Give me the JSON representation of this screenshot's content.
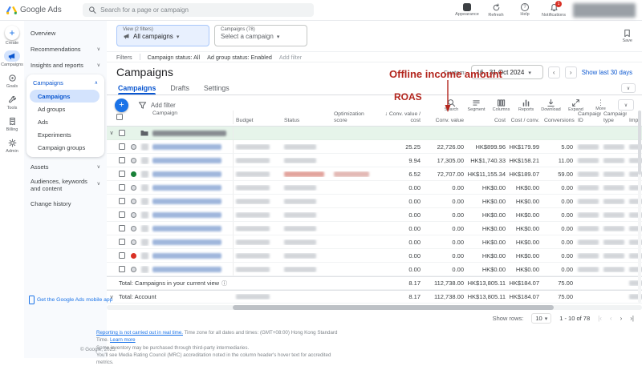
{
  "topbar": {
    "logo_text": "Google Ads",
    "search_placeholder": "Search for a page or campaign",
    "actions": [
      {
        "label": "Appearance"
      },
      {
        "label": "Refresh"
      },
      {
        "label": "Help"
      },
      {
        "label": "Notifications",
        "badge": "1"
      }
    ]
  },
  "rail": [
    {
      "label": "Create"
    },
    {
      "label": "Campaigns"
    },
    {
      "label": "Goals"
    },
    {
      "label": "Tools"
    },
    {
      "label": "Billing"
    },
    {
      "label": "Admin"
    }
  ],
  "nav": {
    "overview": "Overview",
    "recommendations": "Recommendations",
    "insights": "Insights and reports",
    "campaigns_parent": "Campaigns",
    "campaigns_children": [
      "Campaigns",
      "Ad groups",
      "Ads",
      "Experiments",
      "Campaign groups"
    ],
    "assets": "Assets",
    "audiences": "Audiences, keywords and content",
    "change_history": "Change history",
    "mobile_app": "Get the Google Ads mobile app"
  },
  "view_controls": {
    "view_label": "View (2 filters)",
    "view_value": "All campaigns",
    "campaigns_label": "Campaigns (78)",
    "campaigns_value": "Select a campaign",
    "save_label": "Save"
  },
  "filter_bar": {
    "filters_label": "Filters",
    "chip_campaign_status": "Campaign status: All",
    "chip_ad_group_status": "Ad group status: Enabled",
    "add_filter": "Add filter"
  },
  "page": {
    "title": "Campaigns",
    "date_prefix": "Custom:",
    "date_range": "16 - 31 Oct 2024",
    "quick_range": "Show last 30 days"
  },
  "tabs": [
    {
      "label": "Campaigns"
    },
    {
      "label": "Drafts"
    },
    {
      "label": "Settings"
    }
  ],
  "annotations": {
    "offline_income": "Offline income amount",
    "roas": "ROAS"
  },
  "toolbar": {
    "add_filter": "Add filter",
    "tools": [
      {
        "label": "Search"
      },
      {
        "label": "Segment"
      },
      {
        "label": "Columns"
      },
      {
        "label": "Reports"
      },
      {
        "label": "Download"
      },
      {
        "label": "Expand"
      },
      {
        "label": "More"
      }
    ]
  },
  "table": {
    "headers": {
      "campaign": "Campaign",
      "budget": "Budget",
      "status": "Status",
      "opt_score": "Optimization score",
      "conv_value_cost": "↓ Conv. value / cost",
      "conv_value": "Conv. value",
      "cost": "Cost",
      "cost_conv": "Cost / conv.",
      "conversions": "Conversions",
      "campaign_id": "Campaign ID",
      "campaign_type": "Campaign type",
      "impr": "Impr."
    },
    "rows": [
      {
        "kind": "group"
      },
      {
        "kind": "data",
        "dot": "gray",
        "cvc": "25.25",
        "cv": "22,726.00",
        "cost": "HK$899.96",
        "cpc": "HK$179.99",
        "conv": "5.00"
      },
      {
        "kind": "data",
        "dot": "gray",
        "cvc": "9.94",
        "cv": "17,305.00",
        "cost": "HK$1,740.33",
        "cpc": "HK$158.21",
        "conv": "11.00"
      },
      {
        "kind": "data",
        "dot": "green",
        "status_alert": true,
        "opt_blur": true,
        "cvc": "6.52",
        "cv": "72,707.00",
        "cost": "HK$11,155.34",
        "cpc": "HK$189.07",
        "conv": "59.00"
      },
      {
        "kind": "data",
        "dot": "gray",
        "cvc": "0.00",
        "cv": "0.00",
        "cost": "HK$0.00",
        "cpc": "HK$0.00",
        "conv": "0.00"
      },
      {
        "kind": "data",
        "dot": "gray",
        "cvc": "0.00",
        "cv": "0.00",
        "cost": "HK$0.00",
        "cpc": "HK$0.00",
        "conv": "0.00"
      },
      {
        "kind": "data",
        "dot": "gray",
        "cvc": "0.00",
        "cv": "0.00",
        "cost": "HK$0.00",
        "cpc": "HK$0.00",
        "conv": "0.00"
      },
      {
        "kind": "data",
        "dot": "gray",
        "cvc": "0.00",
        "cv": "0.00",
        "cost": "HK$0.00",
        "cpc": "HK$0.00",
        "conv": "0.00"
      },
      {
        "kind": "data",
        "dot": "gray",
        "cvc": "0.00",
        "cv": "0.00",
        "cost": "HK$0.00",
        "cpc": "HK$0.00",
        "conv": "0.00"
      },
      {
        "kind": "data",
        "dot": "red",
        "cvc": "0.00",
        "cv": "0.00",
        "cost": "HK$0.00",
        "cpc": "HK$0.00",
        "conv": "0.00"
      },
      {
        "kind": "data",
        "dot": "gray",
        "cvc": "0.00",
        "cv": "0.00",
        "cost": "HK$0.00",
        "cpc": "HK$0.00",
        "conv": "0.00"
      }
    ],
    "totals": [
      {
        "label": "Total: Campaigns in your current view",
        "cvc": "8.17",
        "cv": "112,738.00",
        "cost": "HK$13,805.11",
        "cpc": "HK$184.07",
        "conv": "75.00"
      },
      {
        "label": "Total: Account",
        "cvc": "8.17",
        "cv": "112,738.00",
        "cost": "HK$13,805.11",
        "cpc": "HK$184.07",
        "conv": "75.00"
      }
    ]
  },
  "pagination": {
    "show_rows_label": "Show rows:",
    "show_rows_value": "10",
    "range": "1 - 10 of 78"
  },
  "footer": {
    "copyright": "© Google, 2025.",
    "line1_link": "Reporting is not carried out in real time.",
    "line1_rest": " Time zone for all dates and times: (GMT+08:00) Hong Kong Standard Time. ",
    "line1_learn": "Learn more",
    "line2": "Some inventory may be purchased through third-party intermediaries.",
    "line3": "You'll see Media Rating Council (MRC) accreditation noted in the column header's hover text for accredited metrics."
  }
}
